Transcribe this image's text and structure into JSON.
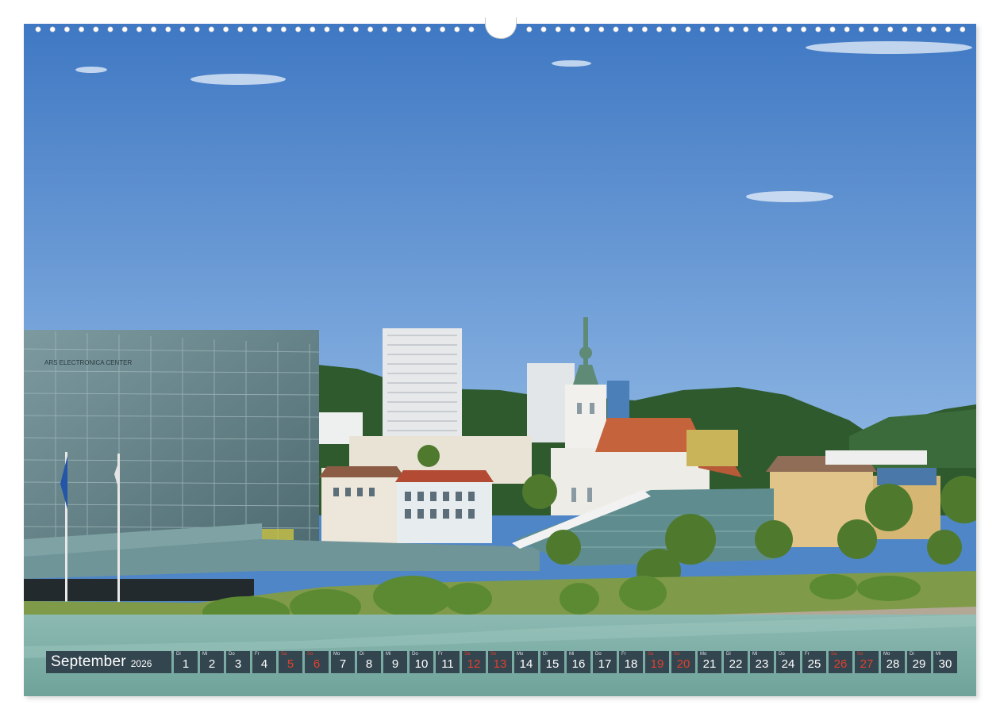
{
  "calendar": {
    "month": "September",
    "year": "2026",
    "weekend_color": "#e2402e",
    "bar_color": "#33454f",
    "days": [
      {
        "wd": "Di",
        "n": "1",
        "we": false
      },
      {
        "wd": "Mi",
        "n": "2",
        "we": false
      },
      {
        "wd": "Do",
        "n": "3",
        "we": false
      },
      {
        "wd": "Fr",
        "n": "4",
        "we": false
      },
      {
        "wd": "Sa",
        "n": "5",
        "we": true
      },
      {
        "wd": "So",
        "n": "6",
        "we": true
      },
      {
        "wd": "Mo",
        "n": "7",
        "we": false
      },
      {
        "wd": "Di",
        "n": "8",
        "we": false
      },
      {
        "wd": "Mi",
        "n": "9",
        "we": false
      },
      {
        "wd": "Do",
        "n": "10",
        "we": false
      },
      {
        "wd": "Fr",
        "n": "11",
        "we": false
      },
      {
        "wd": "Sa",
        "n": "12",
        "we": true
      },
      {
        "wd": "So",
        "n": "13",
        "we": true
      },
      {
        "wd": "Mo",
        "n": "14",
        "we": false
      },
      {
        "wd": "Di",
        "n": "15",
        "we": false
      },
      {
        "wd": "Mi",
        "n": "16",
        "we": false
      },
      {
        "wd": "Do",
        "n": "17",
        "we": false
      },
      {
        "wd": "Fr",
        "n": "18",
        "we": false
      },
      {
        "wd": "Sa",
        "n": "19",
        "we": true
      },
      {
        "wd": "So",
        "n": "20",
        "we": true
      },
      {
        "wd": "Mo",
        "n": "21",
        "we": false
      },
      {
        "wd": "Di",
        "n": "22",
        "we": false
      },
      {
        "wd": "Mi",
        "n": "23",
        "we": false
      },
      {
        "wd": "Do",
        "n": "24",
        "we": false
      },
      {
        "wd": "Fr",
        "n": "25",
        "we": false
      },
      {
        "wd": "Sa",
        "n": "26",
        "we": true
      },
      {
        "wd": "So",
        "n": "27",
        "we": true
      },
      {
        "wd": "Mo",
        "n": "28",
        "we": false
      },
      {
        "wd": "Di",
        "n": "29",
        "we": false
      },
      {
        "wd": "Mi",
        "n": "30",
        "we": false
      }
    ]
  },
  "photo": {
    "building_sign": "ARS ELECTRONICA CENTER",
    "sky_color": "#4f86c7",
    "river_color": "#7fb0a8"
  }
}
